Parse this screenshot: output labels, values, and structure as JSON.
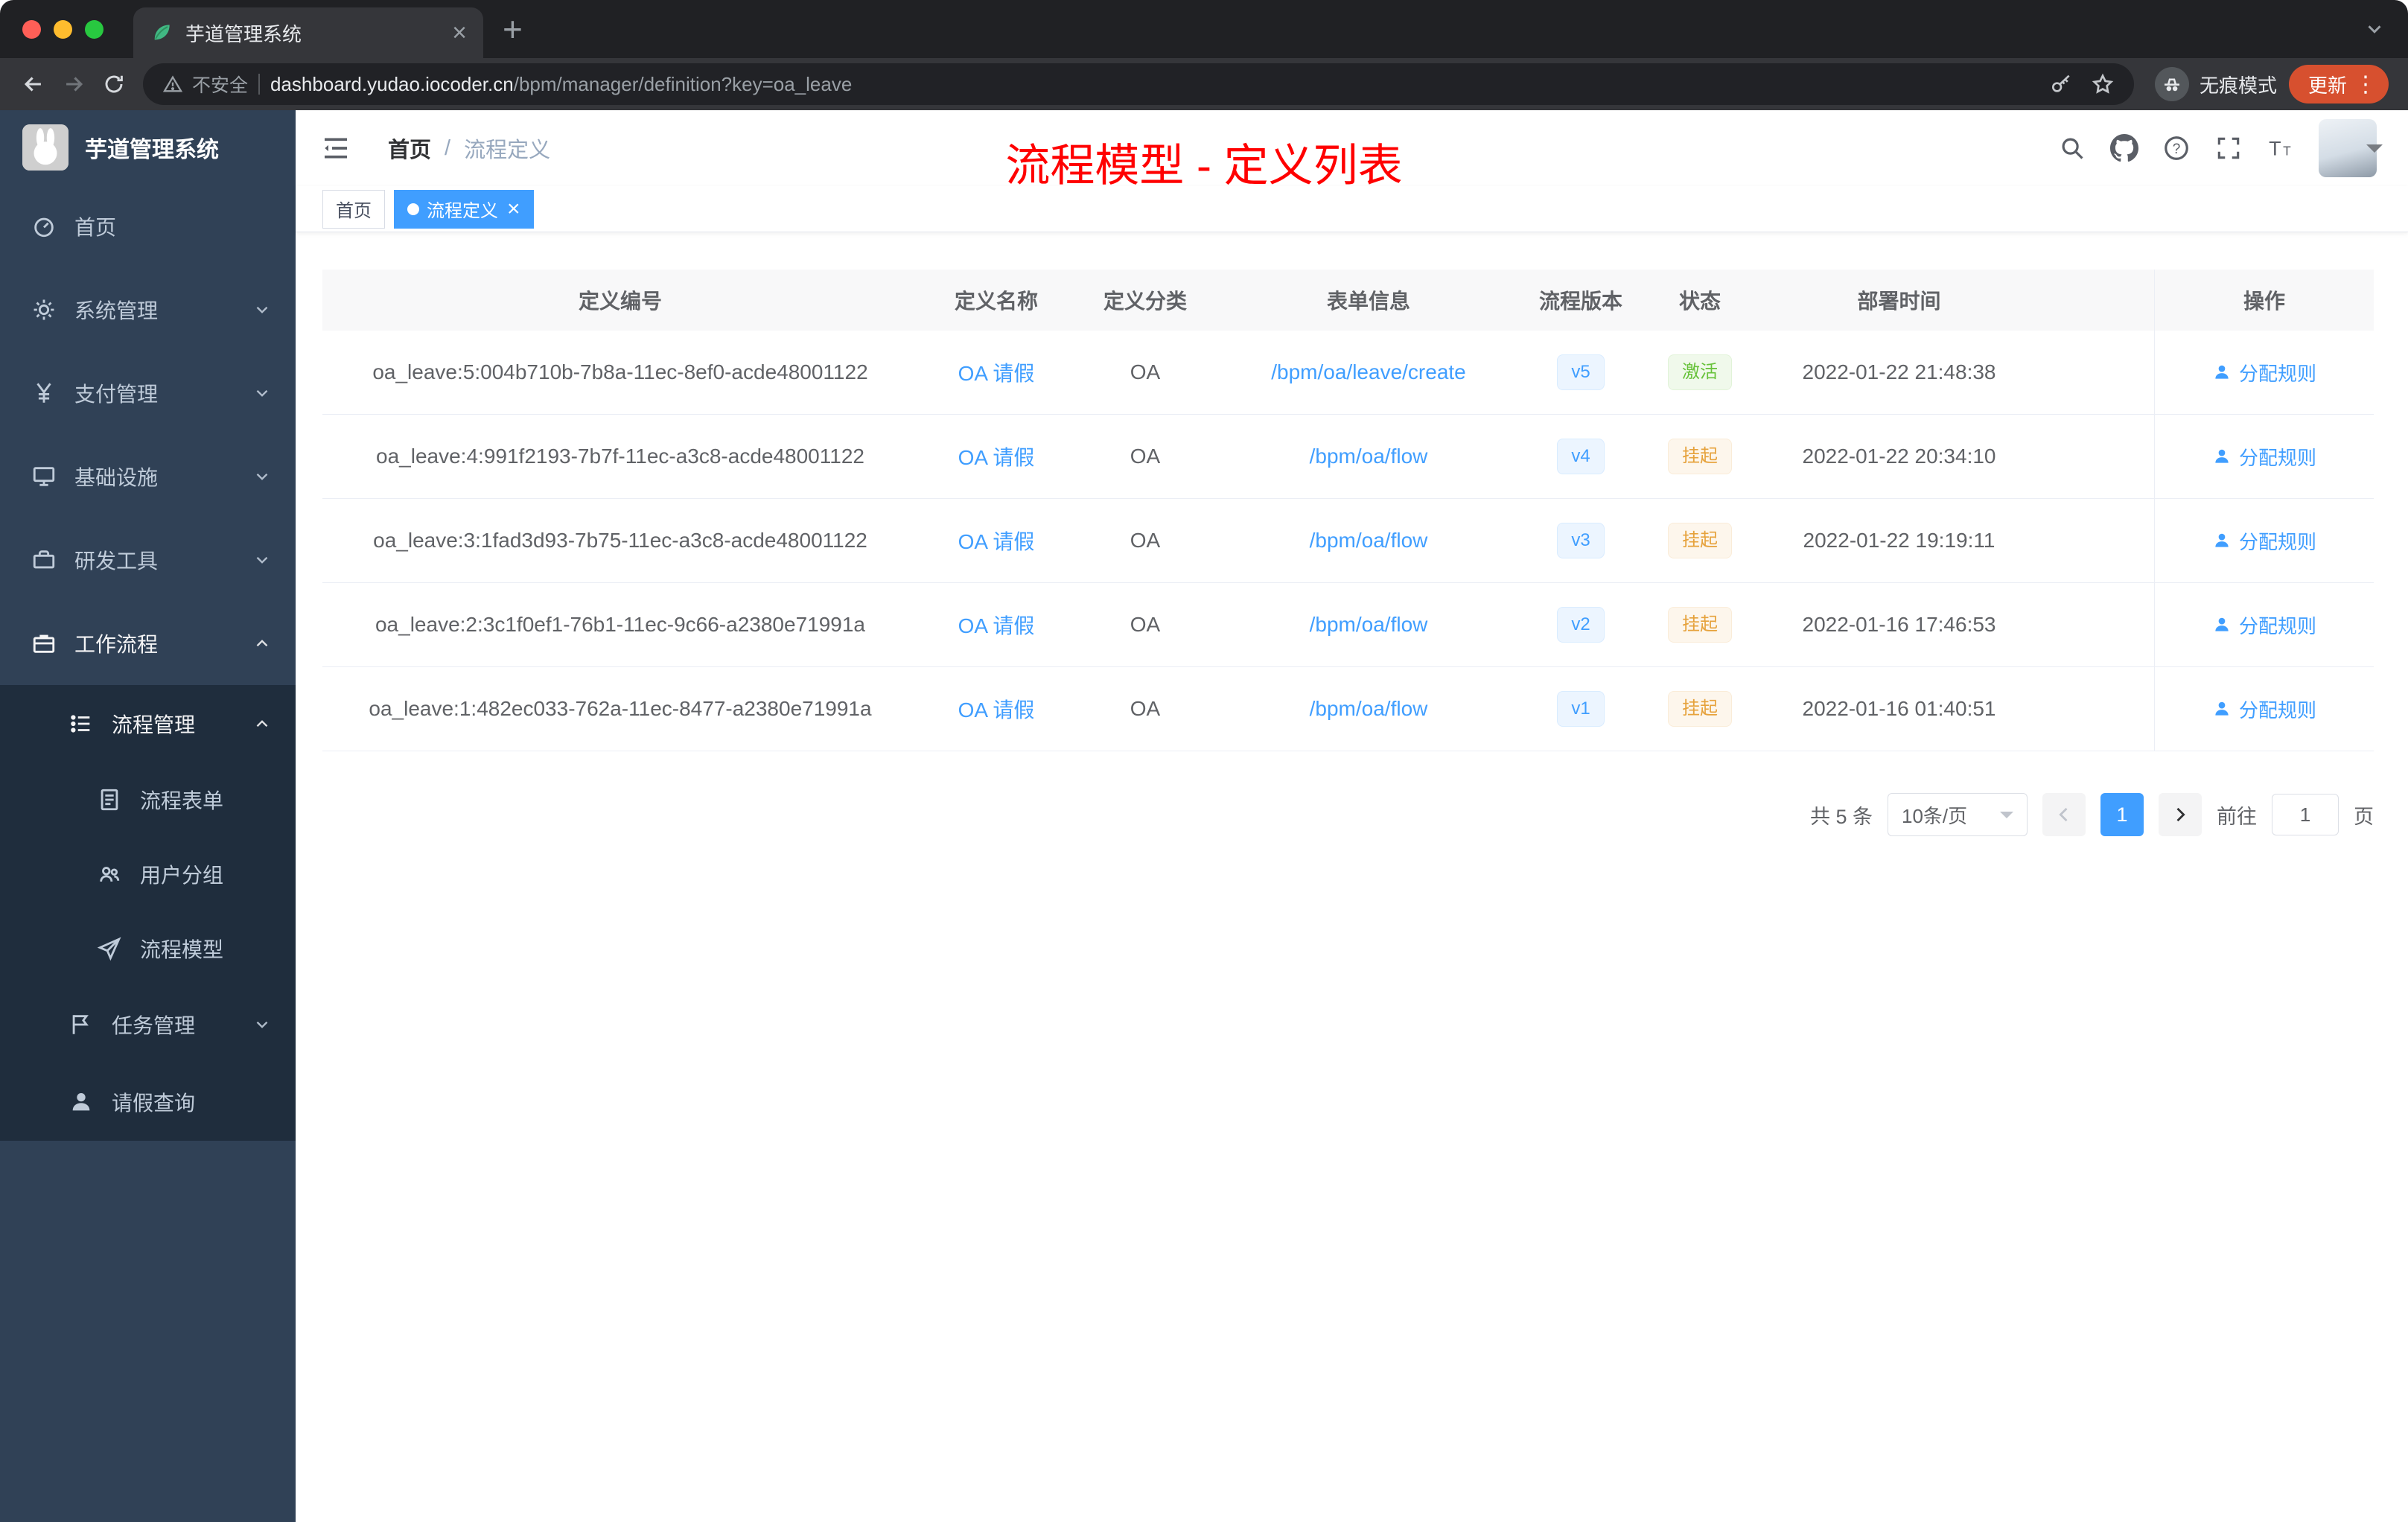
{
  "colors": {
    "accent": "#409EFF",
    "success": "#67C23A",
    "warning": "#E6A23C",
    "annotation_red": "#FF0000",
    "sidebar_bg": "#304156",
    "submenu_bg": "#1F2D3D"
  },
  "browser": {
    "tab_title": "芋道管理系统",
    "tab_close_glyph": "×",
    "new_tab_glyph": "+",
    "security_label": "不安全",
    "url_domain": "dashboard.yudao.iocoder.cn",
    "url_path": "/bpm/manager/definition?key=oa_leave",
    "incognito_label": "无痕模式",
    "update_label": "更新",
    "menu_dots_glyph": "⋮"
  },
  "sidebar": {
    "logo_title": "芋道管理系统",
    "items": [
      {
        "label": "首页"
      },
      {
        "label": "系统管理"
      },
      {
        "label": "支付管理"
      },
      {
        "label": "基础设施"
      },
      {
        "label": "研发工具"
      },
      {
        "label": "工作流程"
      },
      {
        "label": "流程管理"
      },
      {
        "label": "流程表单"
      },
      {
        "label": "用户分组"
      },
      {
        "label": "流程模型"
      },
      {
        "label": "任务管理"
      },
      {
        "label": "请假查询"
      }
    ]
  },
  "navbar": {
    "breadcrumb_home": "首页",
    "breadcrumb_sep": "/",
    "breadcrumb_current": "流程定义"
  },
  "annotation": "流程模型 - 定义列表",
  "tags": {
    "close_glyph": "×",
    "items": [
      {
        "label": "首页"
      },
      {
        "label": "流程定义"
      }
    ]
  },
  "table": {
    "columns": [
      "定义编号",
      "定义名称",
      "定义分类",
      "表单信息",
      "流程版本",
      "状态",
      "部署时间",
      "操作"
    ],
    "action_label": "分配规则",
    "rows": [
      {
        "id": "oa_leave:5:004b710b-7b8a-11ec-8ef0-acde48001122",
        "name": "OA 请假",
        "category": "OA",
        "form": "/bpm/oa/leave/create",
        "version": "v5",
        "status": "激活",
        "time": "2022-01-22 21:48:38"
      },
      {
        "id": "oa_leave:4:991f2193-7b7f-11ec-a3c8-acde48001122",
        "name": "OA 请假",
        "category": "OA",
        "form": "/bpm/oa/flow",
        "version": "v4",
        "status": "挂起",
        "time": "2022-01-22 20:34:10"
      },
      {
        "id": "oa_leave:3:1fad3d93-7b75-11ec-a3c8-acde48001122",
        "name": "OA 请假",
        "category": "OA",
        "form": "/bpm/oa/flow",
        "version": "v3",
        "status": "挂起",
        "time": "2022-01-22 19:19:11"
      },
      {
        "id": "oa_leave:2:3c1f0ef1-76b1-11ec-9c66-a2380e71991a",
        "name": "OA 请假",
        "category": "OA",
        "form": "/bpm/oa/flow",
        "version": "v2",
        "status": "挂起",
        "time": "2022-01-16 17:46:53"
      },
      {
        "id": "oa_leave:1:482ec033-762a-11ec-8477-a2380e71991a",
        "name": "OA 请假",
        "category": "OA",
        "form": "/bpm/oa/flow",
        "version": "v1",
        "status": "挂起",
        "time": "2022-01-16 01:40:51"
      }
    ]
  },
  "pagination": {
    "total": "共 5 条",
    "page_size": "10条/页",
    "current_page": "1",
    "goto_label": "前往",
    "goto_value": "1",
    "page_label": "页"
  }
}
